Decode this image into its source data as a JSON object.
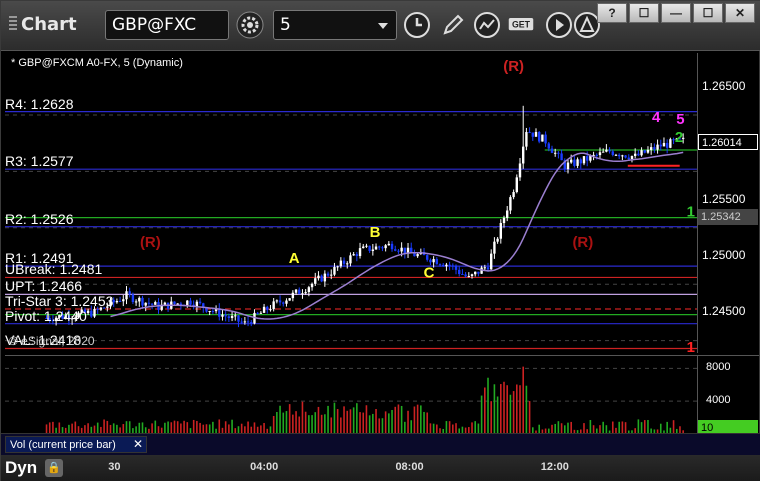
{
  "app": {
    "title": "Chart"
  },
  "toolbar": {
    "symbol": "GBP@FXC",
    "interval": "5",
    "window_buttons": [
      "?",
      "☐",
      "—",
      "☐",
      "✕"
    ]
  },
  "chart": {
    "header": "* GBP@FXCM A0-FX, 5 (Dynamic)",
    "copyright": "© eSignal, 2020",
    "pivots": [
      {
        "label": "R4: 1.2628",
        "value": 1.2628,
        "color": "#2a2ad0",
        "style": "solid"
      },
      {
        "label": "R3: 1.2577",
        "value": 1.2577,
        "color": "#2a2ad0",
        "style": "solid"
      },
      {
        "label": "R2: 1.2526",
        "value": 1.2526,
        "color": "#2a2ad0",
        "style": "solid"
      },
      {
        "label": "R1: 1.2491",
        "value": 1.2491,
        "color": "#2a2ad0",
        "style": "solid"
      },
      {
        "label": "UBreak: 1.2481",
        "value": 1.2481,
        "color": "#cc2222",
        "style": "solid"
      },
      {
        "label": "UPT: 1.2466",
        "value": 1.2466,
        "color": "#c0a0e0",
        "style": "solid"
      },
      {
        "label": "Tri-Star 3: 1.2453",
        "value": 1.2453,
        "color": "#cc2222",
        "style": "dashed"
      },
      {
        "label": "Pivot: 1.2440",
        "value": 1.244,
        "color": "#2a2ad0",
        "style": "solid"
      },
      {
        "label": "VAL: 1.2418",
        "value": 1.2418,
        "color": "#cc2222",
        "style": "solid"
      }
    ],
    "green_levels": [
      1.2594,
      1.2534,
      1.2448
    ],
    "dashed_grid": [
      1.2625,
      1.2575,
      1.2525,
      1.2475,
      1.2425
    ],
    "annotations": [
      {
        "text": "(R)",
        "color": "#cc2222",
        "x": 0.72,
        "price": 1.2664
      },
      {
        "text": "(R)",
        "color": "#aa1111",
        "x": 0.195,
        "price": 1.2508
      },
      {
        "text": "(R)",
        "color": "#aa1111",
        "x": 0.82,
        "price": 1.2508
      },
      {
        "text": "A",
        "color": "#ffff33",
        "x": 0.41,
        "price": 1.2494
      },
      {
        "text": "B",
        "color": "#ffff33",
        "x": 0.527,
        "price": 1.2517
      },
      {
        "text": "C",
        "color": "#ffff33",
        "x": 0.605,
        "price": 1.2481
      },
      {
        "text": "4",
        "color": "#ff33ff",
        "x": 0.935,
        "price": 1.2619
      },
      {
        "text": "5",
        "color": "#ff33ff",
        "x": 0.97,
        "price": 1.2617
      },
      {
        "text": "2",
        "color": "#33cc33",
        "x": 0.968,
        "price": 1.2601
      },
      {
        "text": "1",
        "color": "#33cc33",
        "x": 0.985,
        "price": 1.2535
      },
      {
        "text": "1",
        "color": "#ff2222",
        "x": 0.985,
        "price": 1.2415
      }
    ],
    "last_price": "1.26014",
    "last_price_value": 1.26014,
    "ma_price": "1.25342",
    "ma_price_value": 1.25342,
    "y_ticks": [
      "1.26500",
      "1.26000",
      "1.25500",
      "1.25000",
      "1.24500"
    ],
    "y_tick_values": [
      1.265,
      1.26,
      1.255,
      1.25,
      1.245
    ],
    "ylim": [
      1.2414,
      1.268
    ]
  },
  "volume": {
    "label": "Vol (current price bar)",
    "y_ticks": [
      "8000",
      "4000"
    ],
    "y_tick_values": [
      8000,
      4000
    ],
    "last_value": "10",
    "ymax": 9500
  },
  "footer": {
    "left_label": "Dyn",
    "time_labels": [
      "30",
      "04:00",
      "08:00",
      "12:00"
    ],
    "time_positions": [
      0.155,
      0.36,
      0.57,
      0.78
    ]
  },
  "colors": {
    "up_candle": "#ffffff",
    "down_candle": "#1a3cff",
    "ma_line": "#9b7fd0",
    "volume_bar": "#cc2222",
    "volume_up": "#22aa22"
  }
}
